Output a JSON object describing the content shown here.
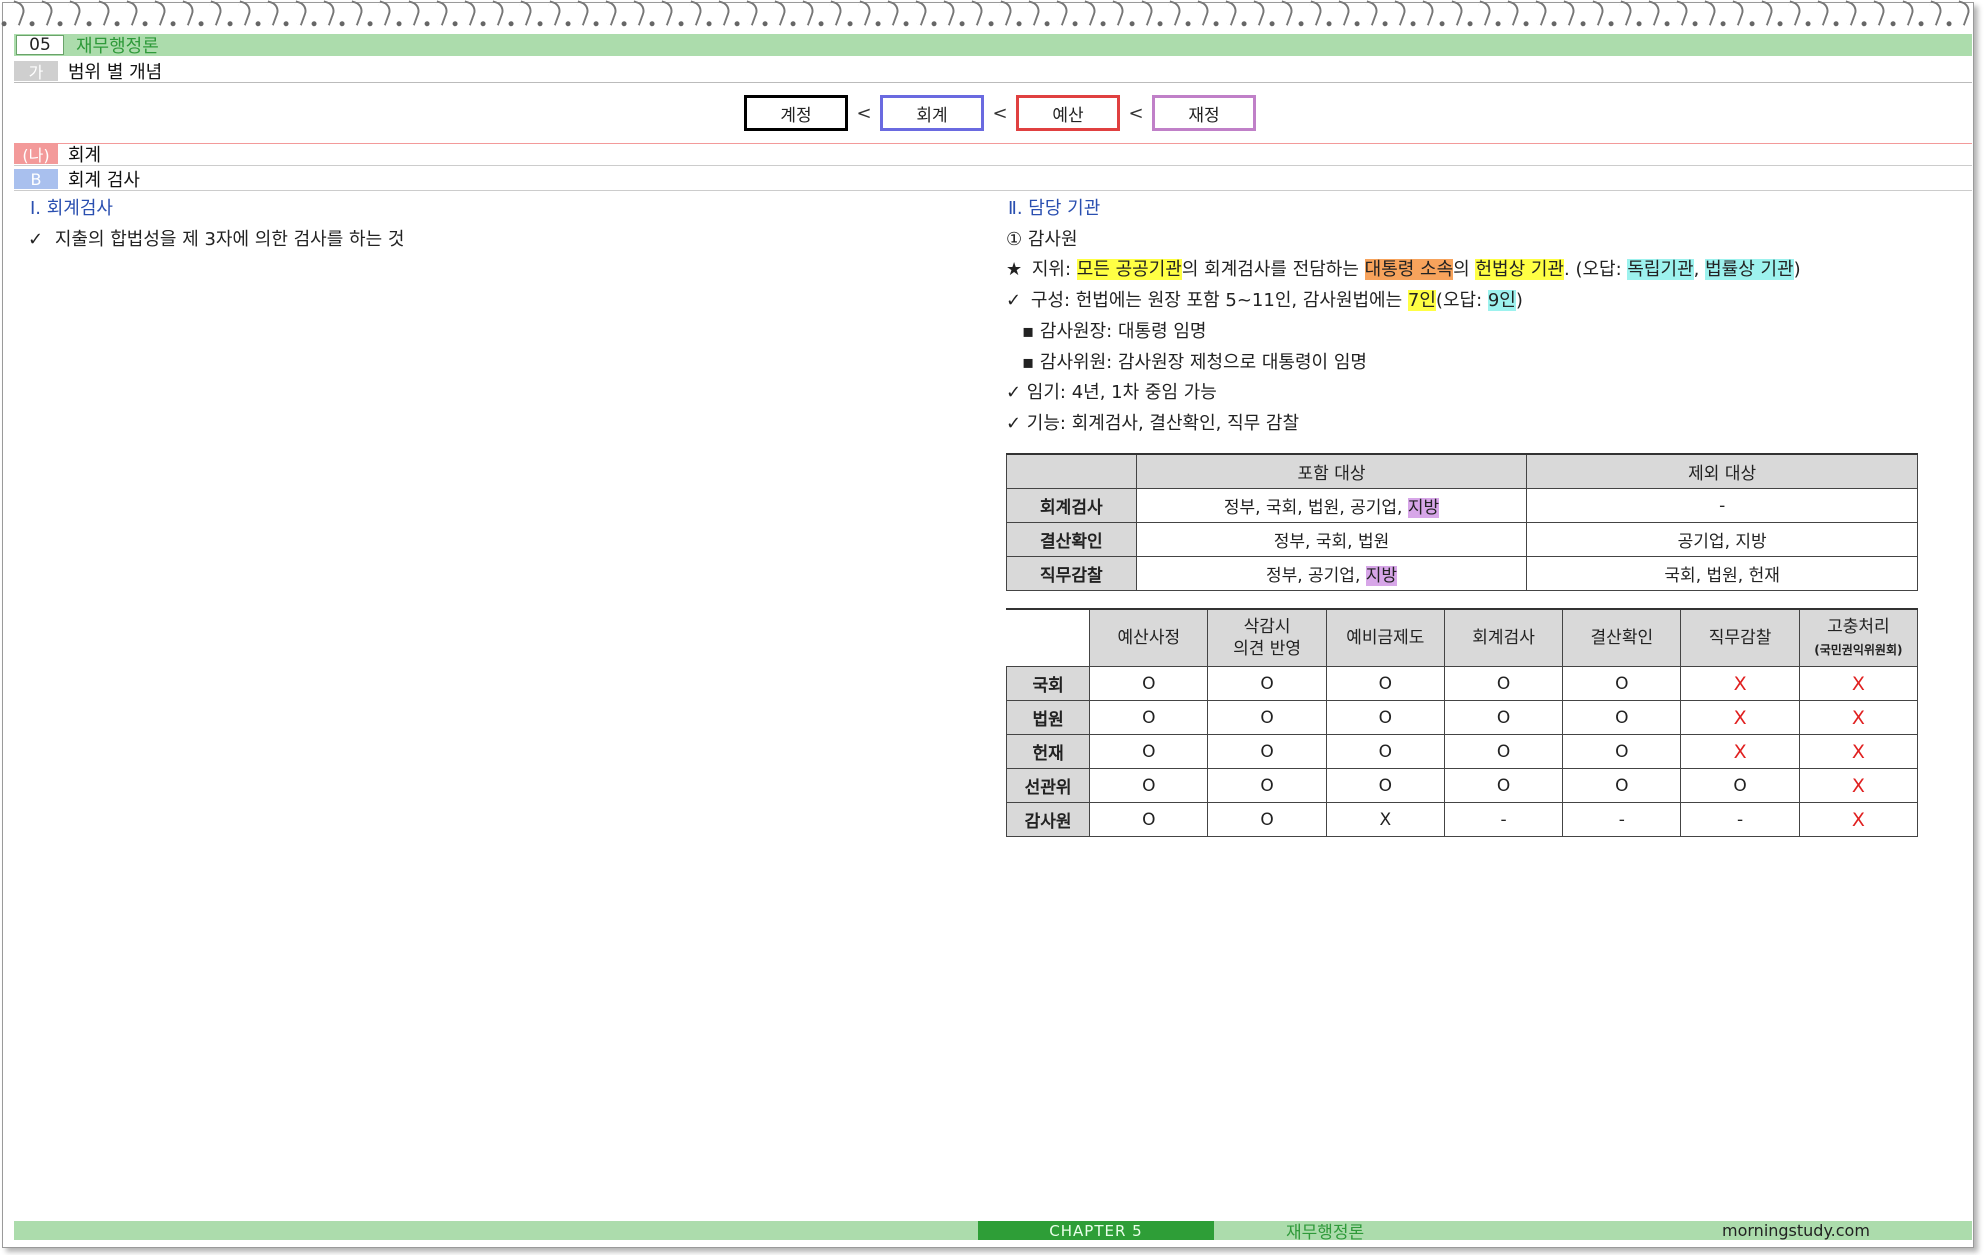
{
  "header": {
    "chapter_num": "05",
    "chapter_title": "재무행정론",
    "section1_tag": "가",
    "section1_title": "범위 별 개념",
    "section2_tag": "(나)",
    "section2_title": "회계",
    "section3_tag": "B",
    "section3_title": "회계 검사"
  },
  "chain": {
    "items": [
      "계정",
      "회계",
      "예산",
      "재정"
    ],
    "separator": "<"
  },
  "left": {
    "heading": "Ⅰ. 회계검사",
    "check": "✓",
    "line1": "지출의 합법성을 제 3자에 의한 검사를 하는 것"
  },
  "right": {
    "heading": "Ⅱ. 담당 기관",
    "org": "① 감사원",
    "status": {
      "star": "★",
      "label": "지위: ",
      "part1": "모든 공공기관",
      "part2": "의 회계검사를 전담하는 ",
      "part3": "대통령 소속",
      "part4": "의 ",
      "part5": "헌법상 기관",
      "part6": ". (오답: ",
      "part7": "독립기관",
      "part8": ", ",
      "part9": "법률상 기관",
      "part10": ")"
    },
    "composition": {
      "check": "✓",
      "part1": "구성: 헌법에는 원장 포함 5~11인, 감사원법에는 ",
      "part2": "7인",
      "part3": "(오답: ",
      "part4": "9인",
      "part5": ")"
    },
    "chair": "▪ 감사원장: 대통령 임명",
    "members": "▪ 감사위원: 감사원장 제청으로 대통령이 임명",
    "term": "✓ 임기: 4년, 1차 중임 가능",
    "function": "✓ 기능: 회계검사, 결산확인, 직무 감찰"
  },
  "table1": {
    "headers": [
      "",
      "포함 대상",
      "제외 대상"
    ],
    "rows": [
      {
        "label": "회계검사",
        "incl_main": "정부, 국회, 법원, 공기업, ",
        "incl_hl": "지방",
        "excl": "-"
      },
      {
        "label": "결산확인",
        "incl_main": "정부, 국회, 법원",
        "incl_hl": "",
        "excl": "공기업, 지방"
      },
      {
        "label": "직무감찰",
        "incl_main": "정부, 공기업, ",
        "incl_hl": "지방",
        "excl": "국회, 법원, 헌재"
      }
    ]
  },
  "table2": {
    "headers": [
      "예산사정",
      "삭감시",
      "의견 반영",
      "예비금제도",
      "회계검사",
      "결산확인",
      "직무감찰",
      "고충처리",
      "(국민권익위원회)"
    ],
    "rows": [
      {
        "label": "국회",
        "cells": [
          "O",
          "O",
          "O",
          "O",
          "O",
          "X",
          "X"
        ]
      },
      {
        "label": "법원",
        "cells": [
          "O",
          "O",
          "O",
          "O",
          "O",
          "X",
          "X"
        ]
      },
      {
        "label": "헌재",
        "cells": [
          "O",
          "O",
          "O",
          "O",
          "O",
          "X",
          "X"
        ]
      },
      {
        "label": "선관위",
        "cells": [
          "O",
          "O",
          "O",
          "O",
          "O",
          "O",
          "X"
        ]
      },
      {
        "label": "감사원",
        "cells": [
          "O",
          "O",
          "X",
          "-",
          "-",
          "-",
          "X"
        ]
      }
    ]
  },
  "footer": {
    "chapter": "CHAPTER 5",
    "subject": "재무행정론",
    "site": "morningstudy.com"
  },
  "colors": {
    "chain_border_1": "#000000",
    "chain_border_2": "#6a6ae0",
    "chain_border_3": "#e04040",
    "chain_border_4": "#c080c8",
    "red_x": "#e02020"
  }
}
